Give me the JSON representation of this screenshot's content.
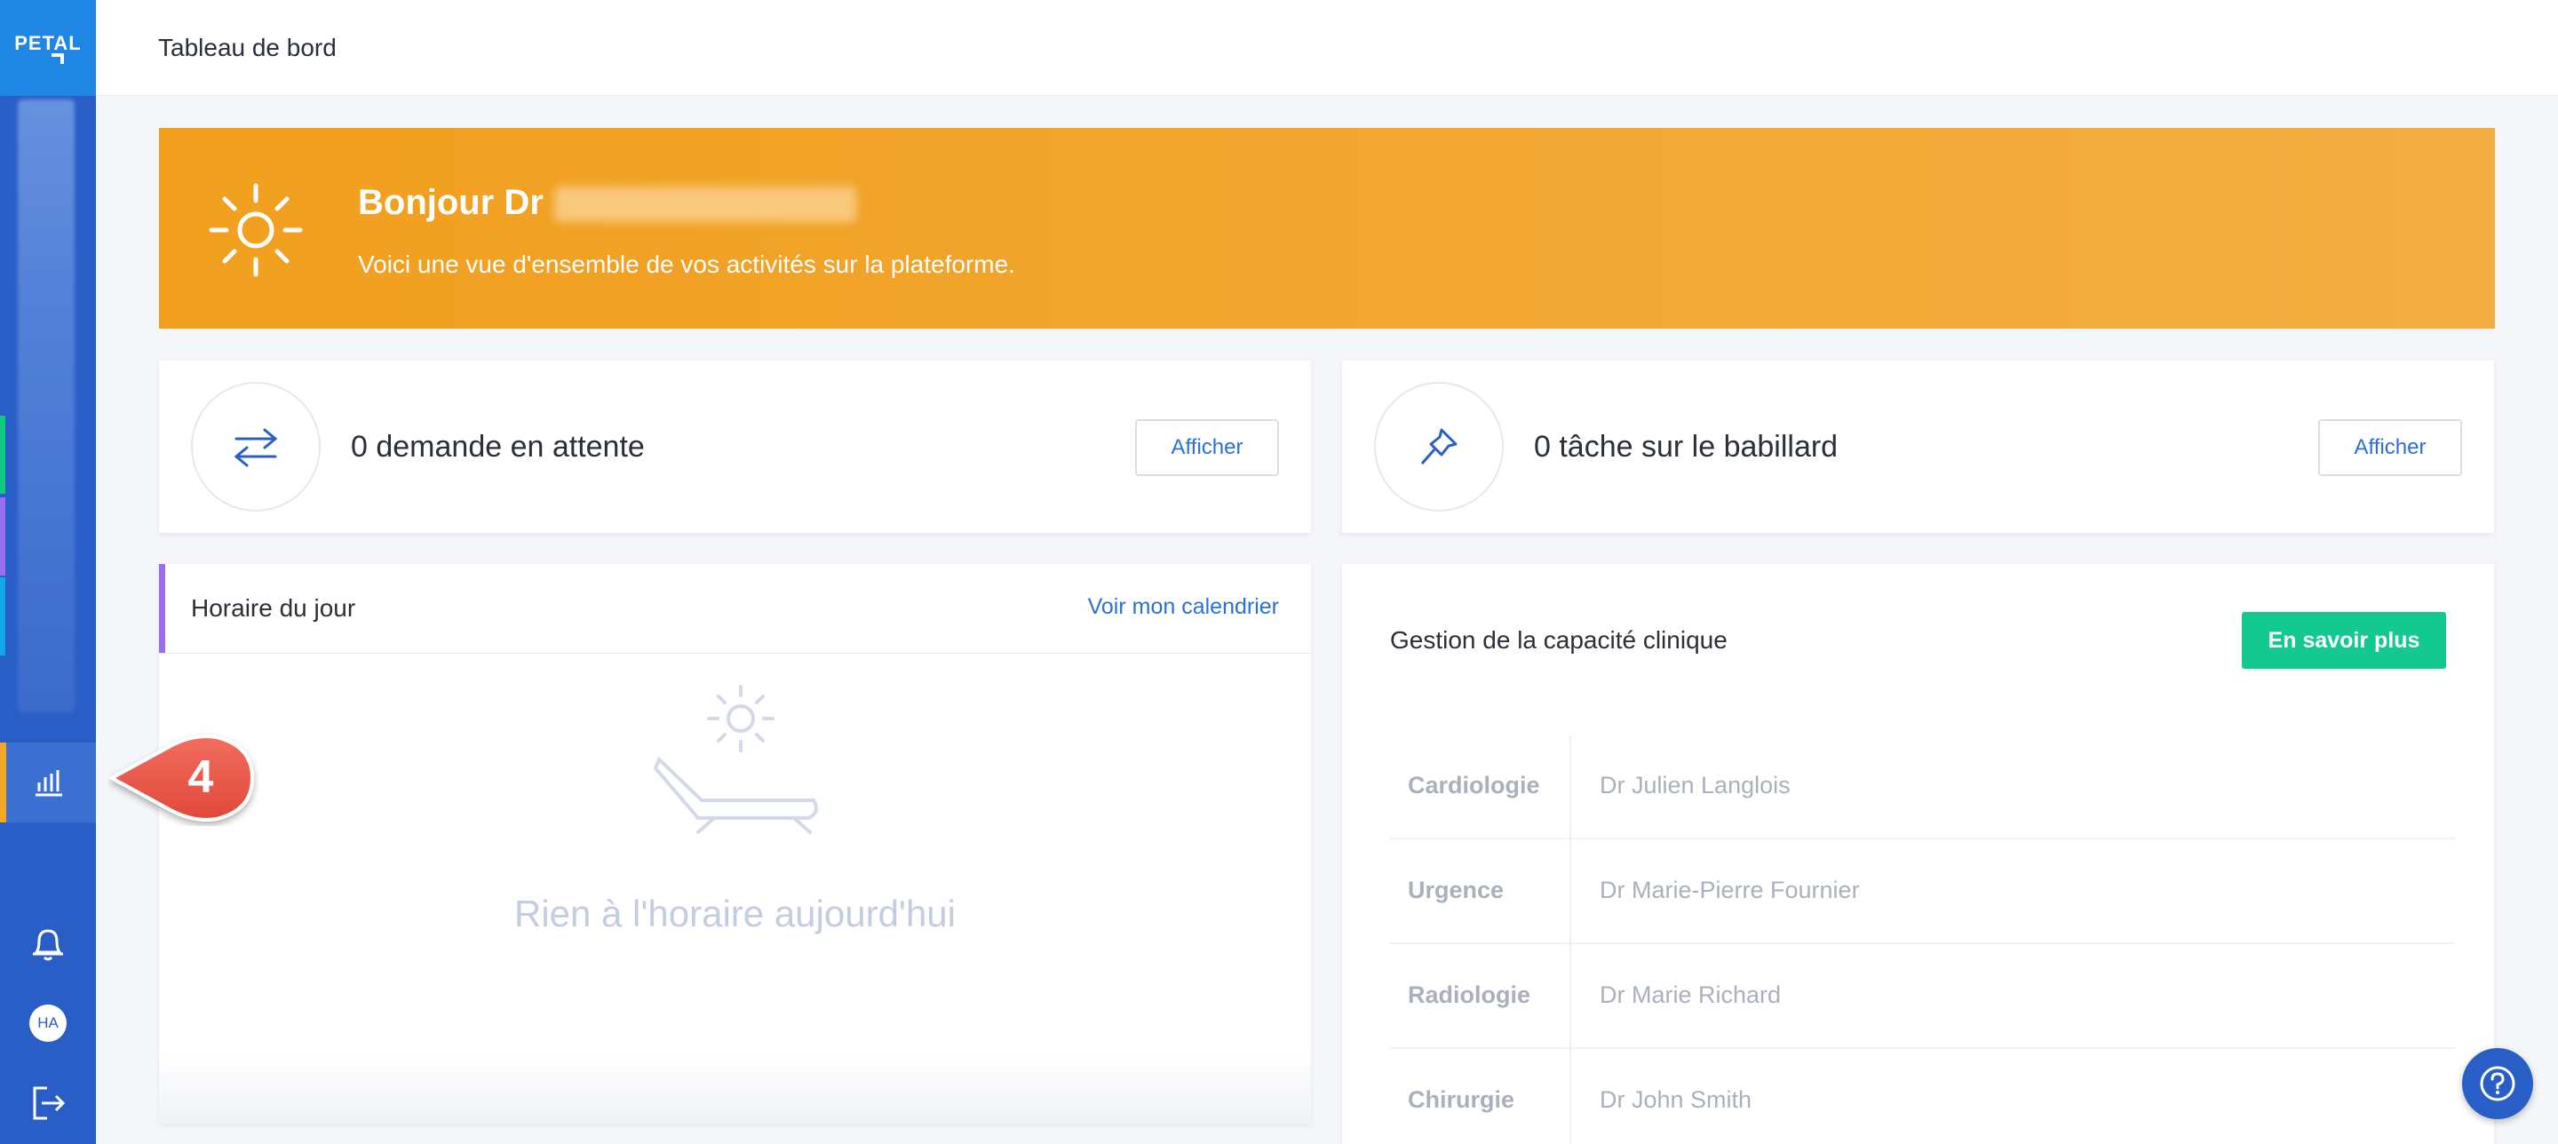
{
  "app": {
    "logo": "PETAL"
  },
  "header": {
    "title": "Tableau de bord"
  },
  "banner": {
    "greeting": "Bonjour Dr",
    "subtitle": "Voici une vue d'ensemble de vos activités sur la plateforme."
  },
  "stats": [
    {
      "text": "0 demande en attente",
      "button": "Afficher",
      "icon": "arrows-swap-icon"
    },
    {
      "text": "0 tâche sur le babillard",
      "button": "Afficher",
      "icon": "pin-icon"
    }
  ],
  "schedule": {
    "title": "Horaire du jour",
    "link": "Voir mon calendrier",
    "empty": "Rien à l'horaire aujourd'hui"
  },
  "capacity": {
    "title": "Gestion de la capacité clinique",
    "button": "En savoir plus",
    "rows": [
      {
        "specialty": "Cardiologie",
        "doctor": "Dr Julien Langlois"
      },
      {
        "specialty": "Urgence",
        "doctor": "Dr Marie-Pierre Fournier"
      },
      {
        "specialty": "Radiologie",
        "doctor": "Dr Marie Richard"
      },
      {
        "specialty": "Chirurgie",
        "doctor": "Dr John Smith"
      }
    ]
  },
  "user": {
    "initials": "HA"
  },
  "callout": {
    "number": "4"
  },
  "colors": {
    "accent": "#2a5ec7",
    "banner": "#f19f1e",
    "green": "#14c98f",
    "active": "#f5a623"
  }
}
